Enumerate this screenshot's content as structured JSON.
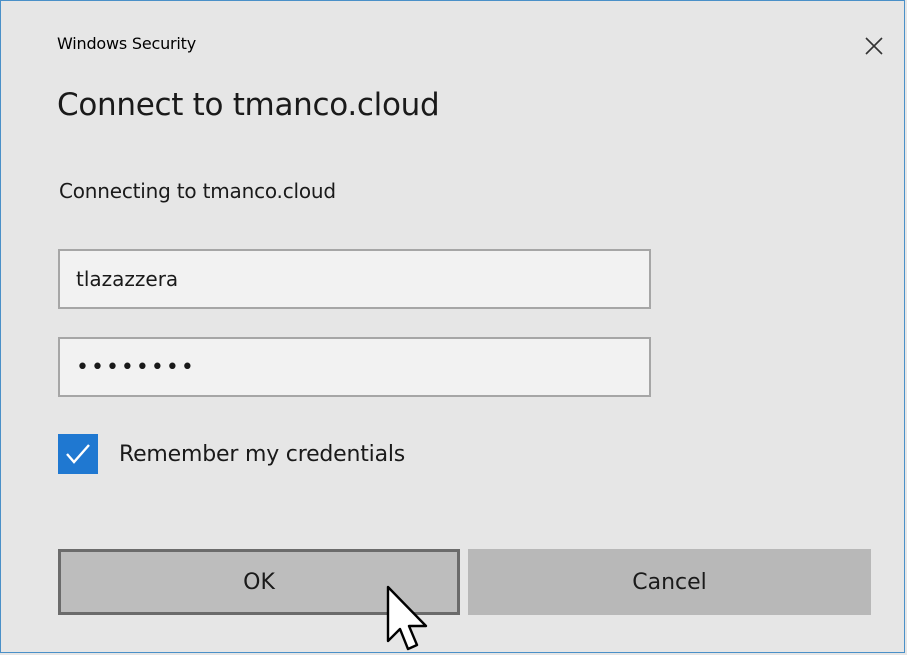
{
  "window": {
    "title": "Windows Security",
    "close_icon": "close-icon"
  },
  "dialog": {
    "heading": "Connect to tmanco.cloud",
    "message": "Connecting to tmanco.cloud"
  },
  "fields": {
    "username_value": "tlazazzera",
    "password_value": "••••••••"
  },
  "remember": {
    "label": "Remember my credentials",
    "checked": true,
    "check_icon": "checkmark-icon"
  },
  "buttons": {
    "ok_label": "OK",
    "cancel_label": "Cancel"
  },
  "cursor_icon": "mouse-pointer-icon",
  "colors": {
    "accent": "#1f78d1",
    "window_border": "#4a90c8",
    "background": "#e6e6e6"
  }
}
